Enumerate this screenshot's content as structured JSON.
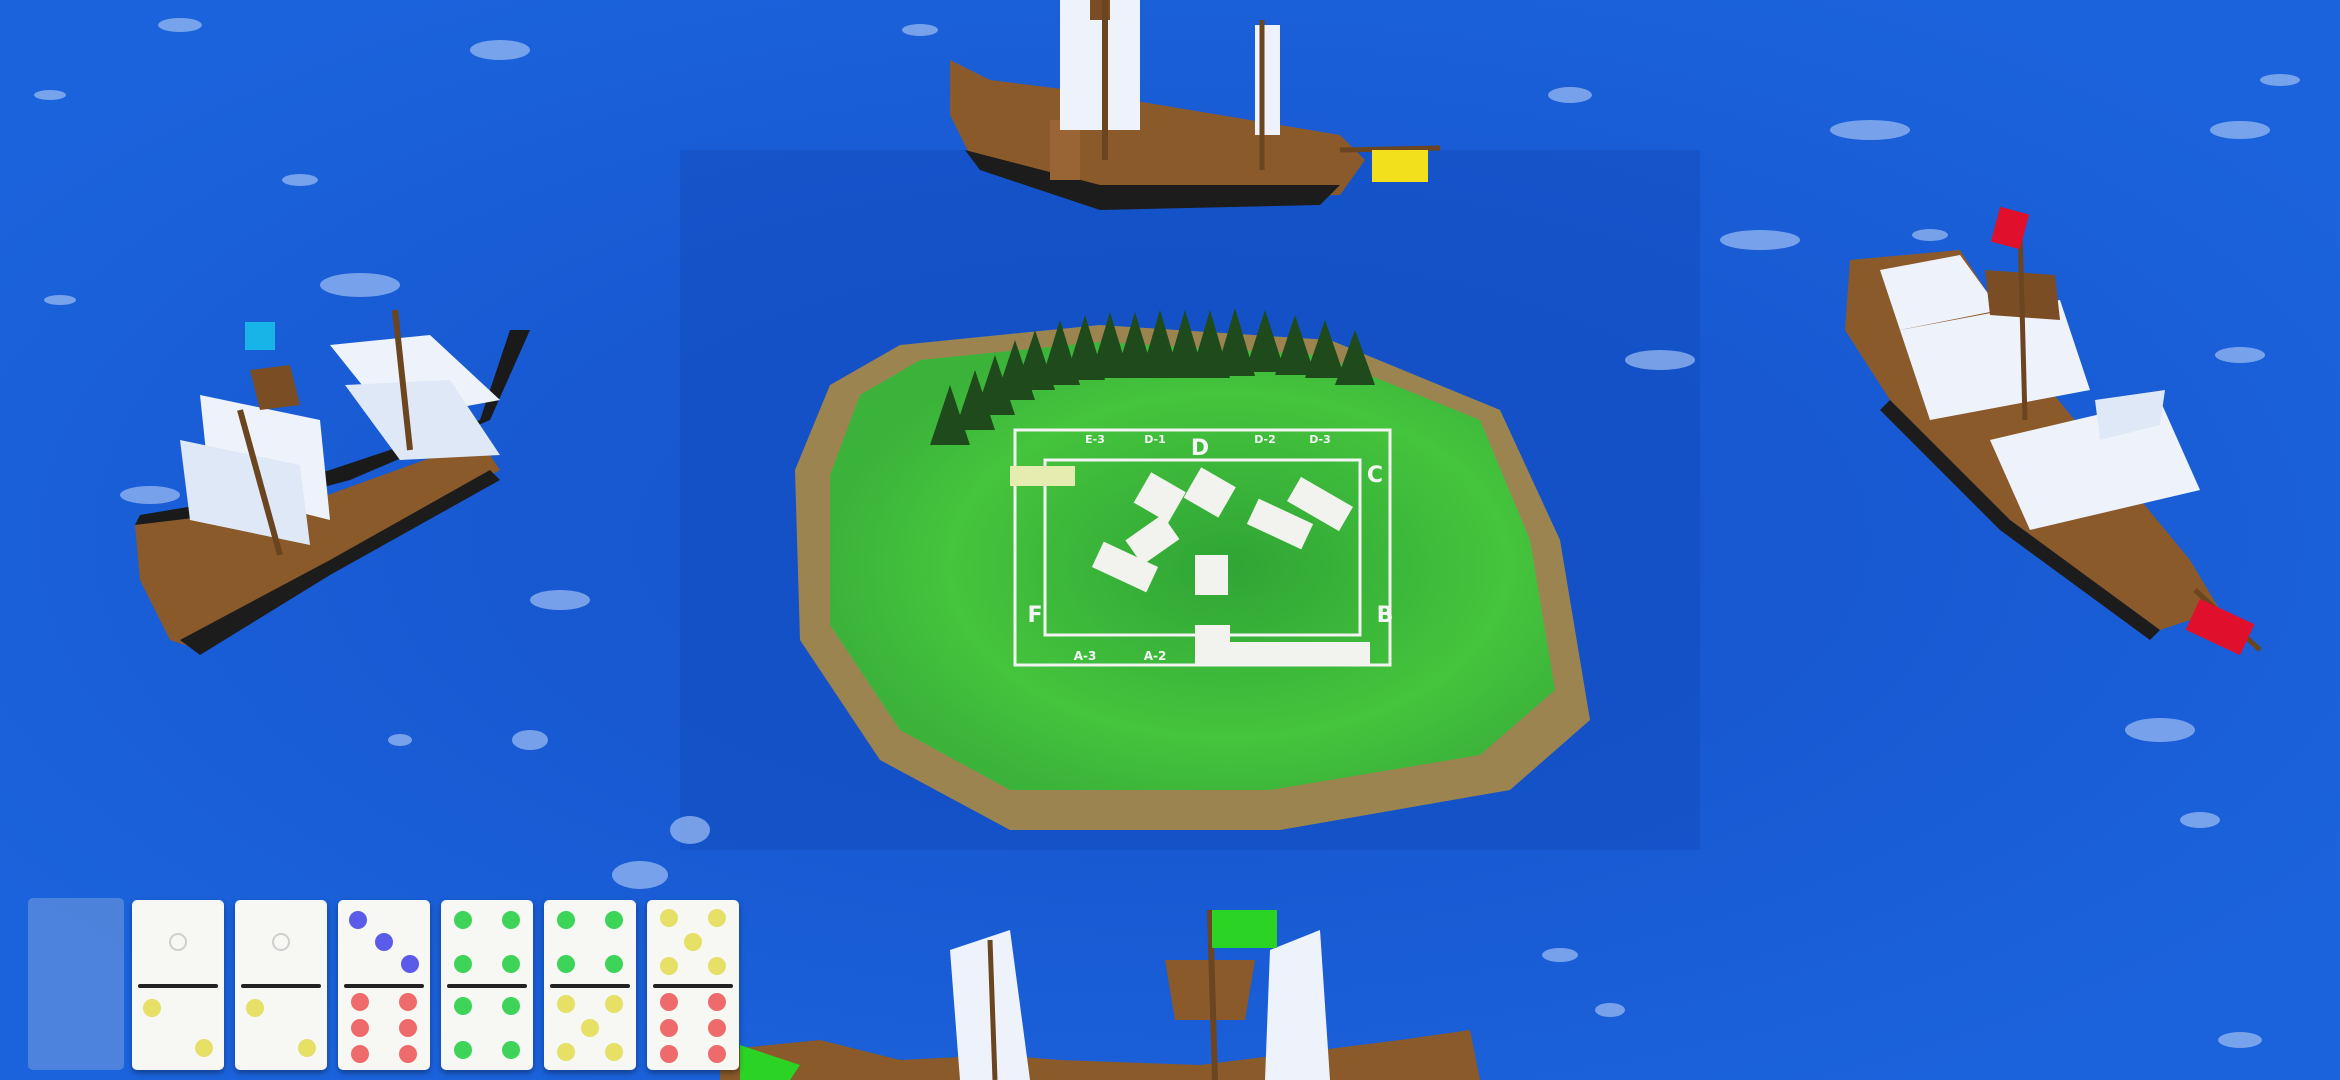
{
  "board": {
    "letters": [
      "A",
      "B",
      "C",
      "D",
      "E",
      "F"
    ],
    "labels_top": [
      "E-3",
      "D-1",
      "D-2",
      "D-3"
    ],
    "labels_bottom": [
      "A-3",
      "A-2"
    ],
    "label_d": "D",
    "label_c": "C",
    "label_b": "B",
    "label_f": "F"
  },
  "ships": {
    "top_flag": "yellow",
    "left_flag": "cyan",
    "right_flag": "red",
    "bottom_flag": "green"
  },
  "colors": {
    "sea": "#1a5fd6",
    "island_grass": "#3fbf3a",
    "island_sand": "#9c8450",
    "hull": "#8b5a2b",
    "sail": "#eef3fb",
    "flag_yellow": "#f2e01c",
    "flag_cyan": "#18b4e8",
    "flag_red": "#e0102c",
    "flag_green": "#2bd424"
  },
  "hand": [
    {
      "top": {
        "count": 1,
        "color": "#d9d9d9",
        "empty": true
      },
      "bottom": {
        "count": 2,
        "color": "#e6e066"
      }
    },
    {
      "top": {
        "count": 1,
        "color": "#d9d9d9",
        "empty": true
      },
      "bottom": {
        "count": 2,
        "color": "#e6e066"
      }
    },
    {
      "top": {
        "count": 3,
        "color": "#5b5bea"
      },
      "bottom": {
        "count": 6,
        "color": "#ef6b6b"
      }
    },
    {
      "top": {
        "count": 4,
        "color": "#3ed45a"
      },
      "bottom": {
        "count": 4,
        "color": "#3ed45a"
      }
    },
    {
      "top": {
        "count": 4,
        "color": "#3ed45a"
      },
      "bottom": {
        "count": 5,
        "color": "#e6e066"
      }
    },
    {
      "top": {
        "count": 5,
        "color": "#e6e066"
      },
      "bottom": {
        "count": 6,
        "color": "#ef6b6b"
      }
    }
  ]
}
